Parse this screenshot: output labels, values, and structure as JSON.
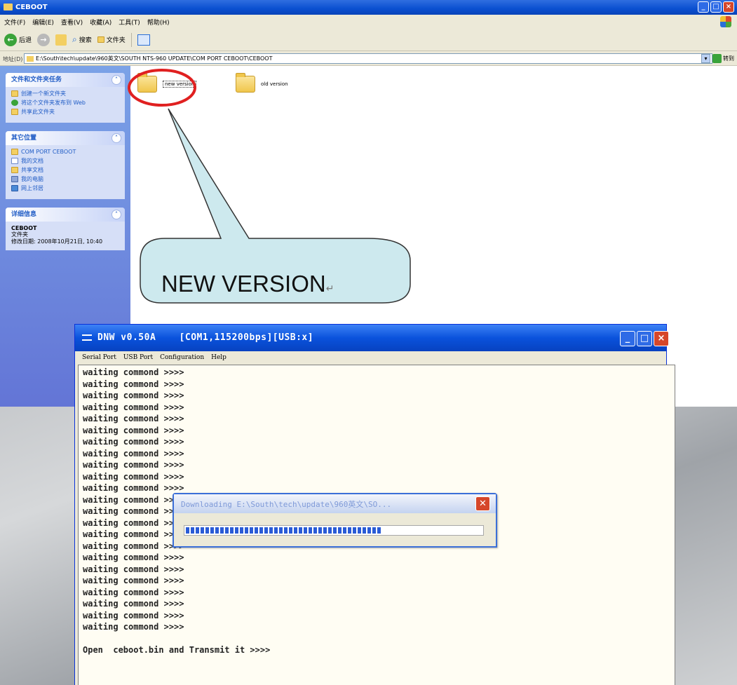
{
  "explorer": {
    "title": "CEBOOT",
    "menu": [
      "文件(F)",
      "编辑(E)",
      "查看(V)",
      "收藏(A)",
      "工具(T)",
      "帮助(H)"
    ],
    "toolbar": {
      "back_label": "后退",
      "search_label": "搜索",
      "folders_label": "文件夹"
    },
    "address": {
      "label": "地址(D)",
      "path": "E:\\South\\tech\\update\\960英文\\SOUTH NTS-960 UPDATE\\COM PORT CEBOOT\\CEBOOT",
      "go_label": "转到"
    },
    "sidebar": {
      "tasks": {
        "title": "文件和文件夹任务",
        "items": [
          "创建一个新文件夹",
          "将这个文件夹发布到 Web",
          "共享此文件夹"
        ]
      },
      "places": {
        "title": "其它位置",
        "items": [
          "COM PORT CEBOOT",
          "我的文档",
          "共享文档",
          "我的电脑",
          "网上邻居"
        ]
      },
      "details": {
        "title": "详细信息",
        "name": "CEBOOT",
        "type": "文件夹",
        "modified": "修改日期: 2008年10月21日, 10:40"
      }
    },
    "folders": [
      {
        "label": "new version"
      },
      {
        "label": "old version"
      }
    ]
  },
  "callout": {
    "text": "NEW VERSION",
    "return_mark": "↵"
  },
  "dnw": {
    "title": "DNW v0.50A    [COM1,115200bps][USB:x]",
    "menu": [
      "Serial Port",
      "USB Port",
      "Configuration",
      "Help"
    ],
    "console_lines": [
      "waiting commond >>>>",
      "waiting commond >>>>",
      "waiting commond >>>>",
      "waiting commond >>>>",
      "waiting commond >>>>",
      "waiting commond >>>>",
      "waiting commond >>>>",
      "waiting commond >>>>",
      "waiting commond >>>>",
      "waiting commond >>>>",
      "waiting commond >>>>",
      "waiting commond >>>>",
      "waiting commond >>>>",
      "waiting commond >>>>",
      "waiting commond >>>>",
      "waiting commond >>>>",
      "waiting commond >>>>",
      "waiting commond >>>>",
      "waiting commond >>>>",
      "waiting commond >>>>",
      "waiting commond >>>>",
      "waiting commond >>>>",
      "waiting commond >>>>",
      "",
      "Open  ceboot.bin and Transmit it >>>>"
    ]
  },
  "download": {
    "title": "Downloading E:\\South\\tech\\update\\960英文\\SO...",
    "progress": 0.66
  },
  "colors": {
    "xp_blue": "#0a52dc",
    "callout_fill": "#cde9ee",
    "highlight_circle": "#e02020"
  }
}
